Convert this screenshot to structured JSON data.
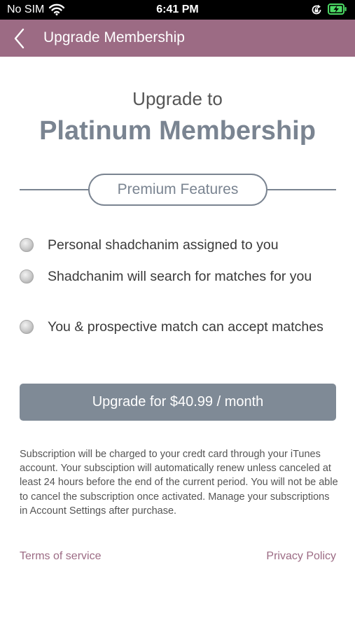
{
  "status_bar": {
    "carrier": "No SIM",
    "time": "6:41 PM",
    "icons": [
      "wifi-icon",
      "orientation-lock-icon",
      "battery-charging-icon"
    ]
  },
  "nav": {
    "back_icon": "chevron-left-icon",
    "title": "Upgrade Membership"
  },
  "header": {
    "line1": "Upgrade to",
    "line2": "Platinum Membership"
  },
  "features": {
    "heading": "Premium Features",
    "items": [
      {
        "label": "Personal shadchanim assigned to you"
      },
      {
        "label": "Shadchanim will search for matches for you"
      },
      {
        "label": "You & prospective match can accept matches"
      }
    ]
  },
  "upgrade_button": {
    "label": "Upgrade for $40.99 / month"
  },
  "disclaimer": "Subscription will be charged to your credt card through your iTunes account. Your subsciption will automatically renew unless canceled at least 24 hours before the end of the current period. You will not be able to cancel the subscription once activated. Manage your subscriptions in Account Settings after purchase.",
  "footer": {
    "terms": "Terms of service",
    "privacy": "Privacy Policy"
  },
  "colors": {
    "nav_bar": "#9c6b84",
    "accent_gray": "#7a8491",
    "button": "#7f8a96",
    "link": "#9c6b84",
    "battery_charging": "#4cd964"
  }
}
